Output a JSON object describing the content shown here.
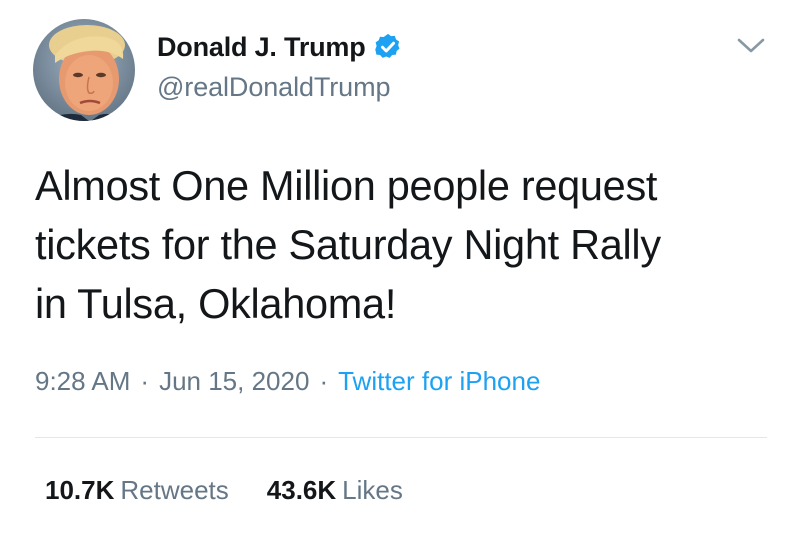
{
  "author": {
    "display_name": "Donald J. Trump",
    "handle": "@realDonaldTrump",
    "verified": true,
    "avatar_icon": "profile-photo"
  },
  "tweet": {
    "text": "Almost One Million people request\ntickets for the Saturday Night Rally\nin Tulsa, Oklahoma!"
  },
  "meta": {
    "time": "9:28 AM",
    "separator": "·",
    "date": "Jun 15, 2020",
    "source": "Twitter for iPhone"
  },
  "stats": {
    "retweets_count": "10.7K",
    "retweets_label": "Retweets",
    "likes_count": "43.6K",
    "likes_label": "Likes"
  },
  "colors": {
    "text_primary": "#14171a",
    "text_secondary": "#657786",
    "accent": "#1da1f2",
    "divider": "#e1e8ed",
    "verified_badge": "#1da1f2"
  },
  "icons": {
    "verified": "verified-badge-icon",
    "menu": "chevron-down-icon"
  }
}
